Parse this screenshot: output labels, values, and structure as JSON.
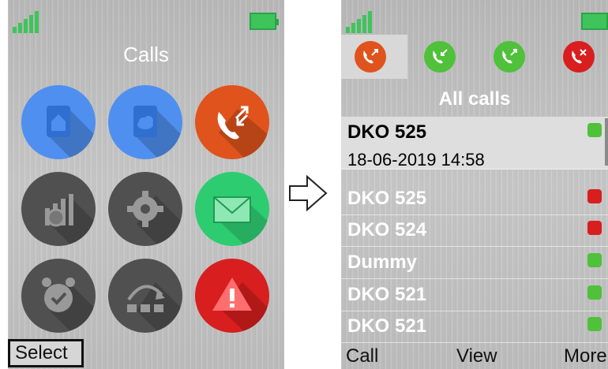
{
  "left_screen": {
    "title": "Calls",
    "softkey_left": "Select",
    "apps": [
      {
        "icon": "phonebook-home-icon",
        "color": "#4f8ff0"
      },
      {
        "icon": "phonebook-cloud-icon",
        "color": "#4f8ff0"
      },
      {
        "icon": "calls-icon",
        "color": "#e0531c"
      },
      {
        "icon": "system-settings-icon",
        "color": "#505050"
      },
      {
        "icon": "gear-icon",
        "color": "#505050"
      },
      {
        "icon": "envelope-icon",
        "color": "#2ecc71"
      },
      {
        "icon": "alarm-clock-icon",
        "color": "#505050"
      },
      {
        "icon": "redirect-icon",
        "color": "#505050"
      },
      {
        "icon": "warning-icon",
        "color": "#d81e1e"
      }
    ]
  },
  "right_screen": {
    "tabs": [
      {
        "icon": "all-calls-icon",
        "color": "#e0531c",
        "active": true
      },
      {
        "icon": "received-calls-icon",
        "color": "#4fc13a"
      },
      {
        "icon": "dialed-calls-icon",
        "color": "#4fc13a"
      },
      {
        "icon": "missed-calls-icon",
        "color": "#d81e1e"
      }
    ],
    "section_title": "All calls",
    "calls": [
      {
        "name": "DKO 525",
        "datetime": "18-06-2019 14:58",
        "status": "outgoing",
        "selected": true
      },
      {
        "name": "DKO 525",
        "status": "missed"
      },
      {
        "name": "DKO 524",
        "status": "missed"
      },
      {
        "name": "Dummy",
        "status": "outgoing"
      },
      {
        "name": "DKO 521",
        "status": "outgoing"
      },
      {
        "name": "DKO 521",
        "status": "outgoing"
      }
    ],
    "softkeys": {
      "left": "Call",
      "middle": "View",
      "right": "More"
    }
  },
  "colors": {
    "signal": "#3fc45c",
    "outgoing": "#4fc13a",
    "missed": "#d81e1e",
    "accent": "#e0531c"
  }
}
